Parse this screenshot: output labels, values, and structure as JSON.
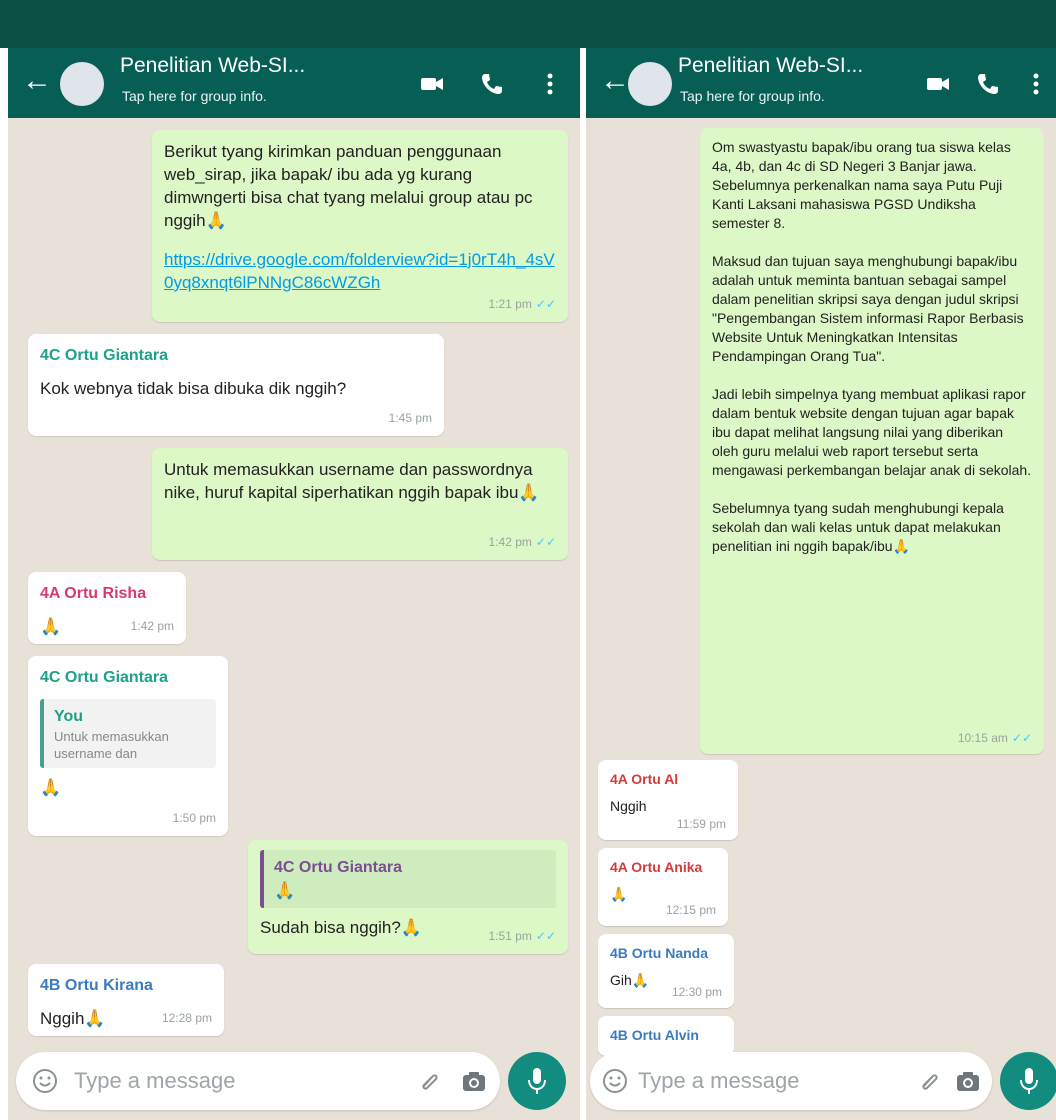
{
  "left": {
    "header": {
      "title": "Penelitian Web-SI...",
      "subtitle": "Tap here for group info."
    },
    "messages": [
      {
        "type": "out",
        "text": "Berikut tyang kirimkan panduan penggunaan web_sirap, jika bapak/ ibu ada yg kurang dimwngerti bisa chat tyang melalui group atau pc nggih",
        "link": "https://drive.google.com/folderview?id=1j0rT4h_4sV0yq8xnqt6lPNNgC86cWZGh",
        "time": "1:21 pm"
      },
      {
        "type": "in",
        "sender": "4C Ortu Giantara",
        "text": "Kok webnya tidak bisa dibuka dik nggih?",
        "time": "1:45 pm"
      },
      {
        "type": "out",
        "text": "Untuk memasukkan username dan passwordnya nike, huruf kapital siperhatikan nggih bapak ibu",
        "time": "1:42 pm"
      },
      {
        "type": "in",
        "sender": "4A Ortu Risha",
        "text": "",
        "time": "1:42 pm"
      },
      {
        "type": "in",
        "sender": "4C Ortu Giantara",
        "quote_name": "You",
        "quote_text": "Untuk memasukkan username dan",
        "text": "",
        "time": "1:50 pm"
      },
      {
        "type": "out",
        "quote_name": "4C Ortu Giantara",
        "text": "Sudah bisa nggih?",
        "time": "1:51 pm"
      },
      {
        "type": "in",
        "sender": "4B Ortu Kirana",
        "text": "Nggih",
        "time": "12:28 pm"
      }
    ],
    "input_placeholder": "Type a message"
  },
  "right": {
    "header": {
      "title": "Penelitian Web-SI...",
      "subtitle": "Tap here for group info."
    },
    "messages": [
      {
        "type": "out",
        "p1": "Om swastyastu bapak/ibu orang tua siswa kelas 4a, 4b, dan 4c di SD Negeri 3 Banjar jawa. Sebelumnya perkenalkan nama saya Putu Puji Kanti Laksani mahasiswa PGSD Undiksha semester 8.",
        "p2": "Maksud dan tujuan saya menghubungi bapak/ibu adalah untuk meminta bantuan sebagai sampel dalam penelitian skripsi saya dengan judul skripsi \"Pengembangan Sistem informasi Rapor Berbasis Website Untuk Meningkatkan Intensitas Pendampingan Orang Tua\".",
        "p3": "Jadi lebih simpelnya tyang membuat aplikasi rapor dalam bentuk website dengan tujuan agar bapak ibu dapat melihat langsung nilai yang diberikan oleh guru melalui web raport tersebut serta mengawasi perkembangan belajar anak di sekolah.",
        "p4": "Sebelumnya tyang sudah menghubungi kepala sekolah dan wali kelas untuk dapat melakukan penelitian ini nggih bapak/ibu",
        "time": "10:15 am"
      },
      {
        "type": "in",
        "sender": "4A Ortu Al",
        "text": "Nggih",
        "time": "11:59 pm"
      },
      {
        "type": "in",
        "sender": "4A Ortu Anika",
        "text": "",
        "time": "12:15 pm"
      },
      {
        "type": "in",
        "sender": "4B Ortu Nanda",
        "text": "Gih",
        "time": "12:30 pm"
      },
      {
        "type": "in",
        "sender": "4B Ortu Alvin",
        "text": "",
        "time": ""
      }
    ],
    "input_placeholder": "Type a message"
  },
  "colors": {
    "header": "#075e54",
    "outgoing": "#dcf8c6",
    "incoming": "#ffffff",
    "accent": "#128c7e",
    "sender_teal": "#1fa088",
    "sender_pink": "#d83a6a",
    "sender_blue": "#3b7bbf",
    "sender_red": "#d43b3b"
  },
  "icons": [
    "back-arrow-icon",
    "avatar",
    "video-call-icon",
    "phone-icon",
    "menu-dots-icon",
    "emoji-icon",
    "attach-icon",
    "camera-icon",
    "mic-icon",
    "double-tick-icon",
    "pray-emoji-icon"
  ]
}
